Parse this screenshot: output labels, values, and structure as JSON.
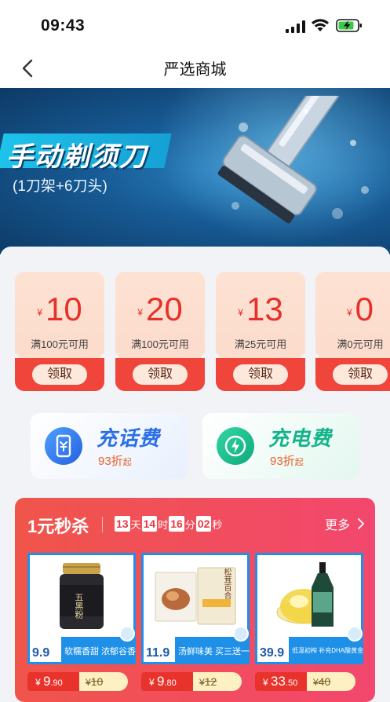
{
  "status_bar": {
    "time": "09:43"
  },
  "nav": {
    "title": "严选商城"
  },
  "banner": {
    "title": "手动剃须刀",
    "subtitle": "(1刀架+6刀头)"
  },
  "coupons": [
    {
      "currency": "¥",
      "amount": "10",
      "condition": "满100元可用",
      "button": "领取"
    },
    {
      "currency": "¥",
      "amount": "20",
      "condition": "满100元可用",
      "button": "领取"
    },
    {
      "currency": "¥",
      "amount": "13",
      "condition": "满25元可用",
      "button": "领取"
    },
    {
      "currency": "¥",
      "amount": "0",
      "condition": "满0元可用",
      "button": "领取"
    }
  ],
  "recharge": [
    {
      "title": "充话费",
      "discount": "93折",
      "suffix": "起",
      "color": "#2a6fe6"
    },
    {
      "title": "充电费",
      "discount": "93折",
      "suffix": "起",
      "color": "#13b48a"
    }
  ],
  "seckill": {
    "title": "1元秒杀",
    "countdown": {
      "days": "13",
      "days_unit": "天",
      "hours": "14",
      "hours_unit": "时",
      "minutes": "16",
      "minutes_unit": "分",
      "seconds": "02",
      "seconds_unit": "秒"
    },
    "more": "更多",
    "products": [
      {
        "strip_price": "9.9",
        "slogan": "软糯香甜  浓郁谷香",
        "price_symbol": "¥",
        "price_int": "9",
        "price_dec": ".90",
        "orig_symbol": "¥",
        "orig_price": "10",
        "label": "五黑粉"
      },
      {
        "strip_price": "11.9",
        "slogan": "汤鲜味美  买三送一",
        "price_symbol": "¥",
        "price_int": "9",
        "price_dec": ".80",
        "orig_symbol": "¥",
        "orig_price": "12",
        "label": "松茸百合"
      },
      {
        "strip_price": "39.9",
        "slogan": "低温初榨  补充DHA酸黄金",
        "price_symbol": "¥",
        "price_int": "33",
        "price_dec": ".50",
        "orig_symbol": "¥",
        "orig_price": "40",
        "label": ""
      }
    ]
  },
  "colors": {
    "accent_red": "#f0453a",
    "brand_blue": "#1e90e8"
  }
}
